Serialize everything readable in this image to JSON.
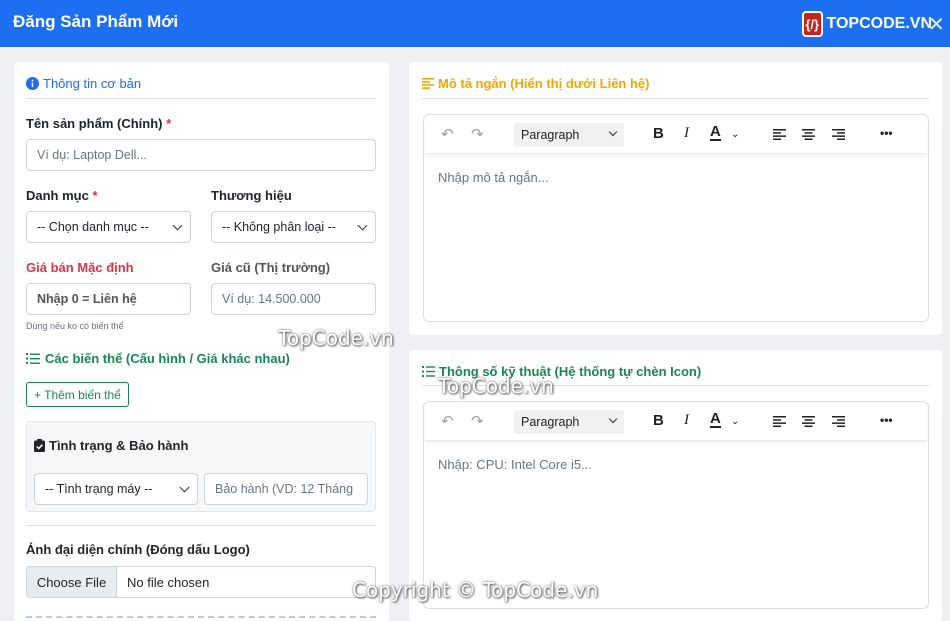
{
  "header": {
    "title": "Đăng Sản Phẩm Mới",
    "logo_text": "TOPCODE.VN"
  },
  "left": {
    "basic_title": "Thông tin cơ bản",
    "name_label": "Tên sản phẩm (Chính)",
    "required_mark": "*",
    "name_placeholder": "Ví dụ: Laptop Dell...",
    "category_label": "Danh mục",
    "category_value": "-- Chọn danh mục --",
    "brand_label": "Thương hiệu",
    "brand_value": "-- Không phân loại --",
    "price_label": "Giá bán Mặc định",
    "price_placeholder": "Nhập 0 = Liên hệ",
    "old_price_label": "Giá cũ (Thị trường)",
    "old_price_placeholder": "Ví dụ: 14.500.000",
    "price_hint": "Dùng nếu ko có biến thể",
    "variants_title": "Các biến thể (Cấu hình / Giá khác nhau)",
    "add_variant_button": "+ Thêm biến thể",
    "warranty_title": "Tình trạng & Bảo hành",
    "condition_value": "-- Tình trạng máy --",
    "warranty_placeholder": "Bảo hành (VD: 12 Tháng",
    "image_label": "Ảnh đại diện chính (Đóng dấu Logo)",
    "choose_file": "Choose File",
    "no_file": "No file chosen"
  },
  "right_top": {
    "title": "Mô tả ngắn (Hiển thị dưới Liên hệ)",
    "paragraph": "Paragraph",
    "placeholder": "Nhập mô tả ngắn..."
  },
  "right_bottom": {
    "title": "Thông số kỹ thuật (Hệ thống tự chèn Icon)",
    "paragraph": "Paragraph",
    "placeholder": "Nhập: CPU: Intel Core i5..."
  },
  "toolbar": {
    "bold": "B",
    "italic": "I",
    "font_color": "A",
    "more": "•••"
  },
  "watermarks": {
    "w1": "TopCode.vn",
    "w2": "TopCode.vn",
    "w3": "Copyright © TopCode.vn"
  },
  "colors": {
    "header": "#1b6ff0",
    "info": "#1b6ff0",
    "orange": "#f0a800",
    "green": "#198754",
    "red": "#dc3545"
  }
}
